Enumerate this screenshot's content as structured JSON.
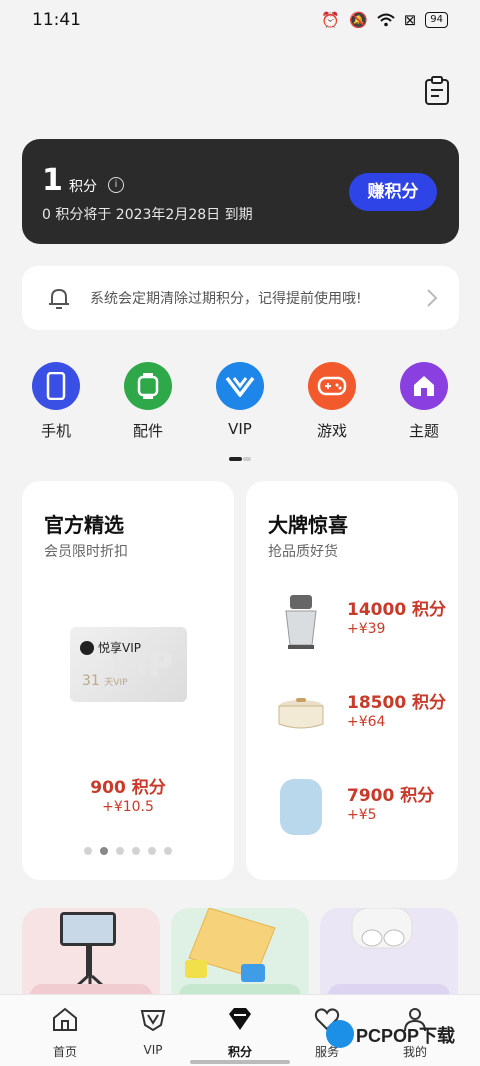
{
  "status": {
    "time": "11:41",
    "battery": "94"
  },
  "points_card": {
    "points": "1",
    "unit": "积分",
    "info": "i",
    "expire_text": "0 积分将于 2023年2月28日 到期",
    "earn_button": "赚积分"
  },
  "notice": {
    "text": "系统会定期清除过期积分，记得提前使用哦!"
  },
  "categories": [
    {
      "label": "手机",
      "color": "#3a4fe3",
      "icon": "phone-icon"
    },
    {
      "label": "配件",
      "color": "#2fa84a",
      "icon": "watch-icon"
    },
    {
      "label": "VIP",
      "color": "#1d86e8",
      "icon": "vip-icon"
    },
    {
      "label": "游戏",
      "color": "#f25a2e",
      "icon": "gamepad-icon"
    },
    {
      "label": "主题",
      "color": "#8a3fe0",
      "icon": "home-theme-icon"
    }
  ],
  "left_panel": {
    "title": "官方精选",
    "subtitle": "会员限时折扣",
    "card_logo": "悦享VIP",
    "card_days": "31",
    "card_days_unit": "天VIP",
    "card_big": "VIP",
    "price": "900 积分",
    "extra": "+¥10.5"
  },
  "right_panel": {
    "title": "大牌惊喜",
    "subtitle": "抢品质好货",
    "products": [
      {
        "points": "14000 积分",
        "cash": "+¥39"
      },
      {
        "points": "18500 积分",
        "cash": "+¥64"
      },
      {
        "points": "7900 积分",
        "cash": "+¥5"
      }
    ]
  },
  "bottom_nav": [
    {
      "label": "首页",
      "icon": "home-icon"
    },
    {
      "label": "VIP",
      "icon": "vip-shield-icon"
    },
    {
      "label": "积分",
      "icon": "diamond-icon"
    },
    {
      "label": "服务",
      "icon": "heart-icon"
    },
    {
      "label": "我的",
      "icon": "user-icon"
    }
  ],
  "watermark": {
    "text": "PCPOP下载"
  },
  "colors": {
    "accent": "#2f44e6",
    "price": "#c83a2a",
    "card_dark": "#2b2b2b"
  }
}
